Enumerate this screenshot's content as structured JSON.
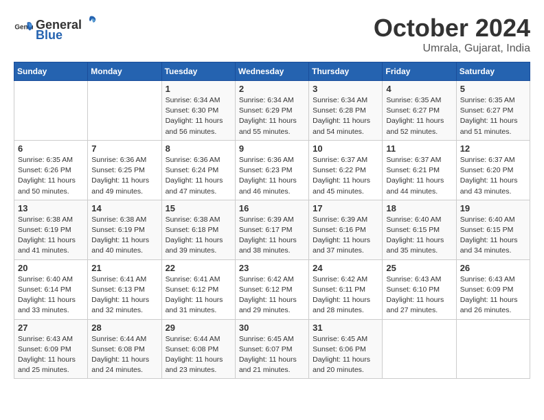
{
  "logo": {
    "general": "General",
    "blue": "Blue"
  },
  "header": {
    "month": "October 2024",
    "location": "Umrala, Gujarat, India"
  },
  "weekdays": [
    "Sunday",
    "Monday",
    "Tuesday",
    "Wednesday",
    "Thursday",
    "Friday",
    "Saturday"
  ],
  "weeks": [
    [
      {
        "day": "",
        "info": ""
      },
      {
        "day": "",
        "info": ""
      },
      {
        "day": "1",
        "info": "Sunrise: 6:34 AM\nSunset: 6:30 PM\nDaylight: 11 hours and 56 minutes."
      },
      {
        "day": "2",
        "info": "Sunrise: 6:34 AM\nSunset: 6:29 PM\nDaylight: 11 hours and 55 minutes."
      },
      {
        "day": "3",
        "info": "Sunrise: 6:34 AM\nSunset: 6:28 PM\nDaylight: 11 hours and 54 minutes."
      },
      {
        "day": "4",
        "info": "Sunrise: 6:35 AM\nSunset: 6:27 PM\nDaylight: 11 hours and 52 minutes."
      },
      {
        "day": "5",
        "info": "Sunrise: 6:35 AM\nSunset: 6:27 PM\nDaylight: 11 hours and 51 minutes."
      }
    ],
    [
      {
        "day": "6",
        "info": "Sunrise: 6:35 AM\nSunset: 6:26 PM\nDaylight: 11 hours and 50 minutes."
      },
      {
        "day": "7",
        "info": "Sunrise: 6:36 AM\nSunset: 6:25 PM\nDaylight: 11 hours and 49 minutes."
      },
      {
        "day": "8",
        "info": "Sunrise: 6:36 AM\nSunset: 6:24 PM\nDaylight: 11 hours and 47 minutes."
      },
      {
        "day": "9",
        "info": "Sunrise: 6:36 AM\nSunset: 6:23 PM\nDaylight: 11 hours and 46 minutes."
      },
      {
        "day": "10",
        "info": "Sunrise: 6:37 AM\nSunset: 6:22 PM\nDaylight: 11 hours and 45 minutes."
      },
      {
        "day": "11",
        "info": "Sunrise: 6:37 AM\nSunset: 6:21 PM\nDaylight: 11 hours and 44 minutes."
      },
      {
        "day": "12",
        "info": "Sunrise: 6:37 AM\nSunset: 6:20 PM\nDaylight: 11 hours and 43 minutes."
      }
    ],
    [
      {
        "day": "13",
        "info": "Sunrise: 6:38 AM\nSunset: 6:19 PM\nDaylight: 11 hours and 41 minutes."
      },
      {
        "day": "14",
        "info": "Sunrise: 6:38 AM\nSunset: 6:19 PM\nDaylight: 11 hours and 40 minutes."
      },
      {
        "day": "15",
        "info": "Sunrise: 6:38 AM\nSunset: 6:18 PM\nDaylight: 11 hours and 39 minutes."
      },
      {
        "day": "16",
        "info": "Sunrise: 6:39 AM\nSunset: 6:17 PM\nDaylight: 11 hours and 38 minutes."
      },
      {
        "day": "17",
        "info": "Sunrise: 6:39 AM\nSunset: 6:16 PM\nDaylight: 11 hours and 37 minutes."
      },
      {
        "day": "18",
        "info": "Sunrise: 6:40 AM\nSunset: 6:15 PM\nDaylight: 11 hours and 35 minutes."
      },
      {
        "day": "19",
        "info": "Sunrise: 6:40 AM\nSunset: 6:15 PM\nDaylight: 11 hours and 34 minutes."
      }
    ],
    [
      {
        "day": "20",
        "info": "Sunrise: 6:40 AM\nSunset: 6:14 PM\nDaylight: 11 hours and 33 minutes."
      },
      {
        "day": "21",
        "info": "Sunrise: 6:41 AM\nSunset: 6:13 PM\nDaylight: 11 hours and 32 minutes."
      },
      {
        "day": "22",
        "info": "Sunrise: 6:41 AM\nSunset: 6:12 PM\nDaylight: 11 hours and 31 minutes."
      },
      {
        "day": "23",
        "info": "Sunrise: 6:42 AM\nSunset: 6:12 PM\nDaylight: 11 hours and 29 minutes."
      },
      {
        "day": "24",
        "info": "Sunrise: 6:42 AM\nSunset: 6:11 PM\nDaylight: 11 hours and 28 minutes."
      },
      {
        "day": "25",
        "info": "Sunrise: 6:43 AM\nSunset: 6:10 PM\nDaylight: 11 hours and 27 minutes."
      },
      {
        "day": "26",
        "info": "Sunrise: 6:43 AM\nSunset: 6:09 PM\nDaylight: 11 hours and 26 minutes."
      }
    ],
    [
      {
        "day": "27",
        "info": "Sunrise: 6:43 AM\nSunset: 6:09 PM\nDaylight: 11 hours and 25 minutes."
      },
      {
        "day": "28",
        "info": "Sunrise: 6:44 AM\nSunset: 6:08 PM\nDaylight: 11 hours and 24 minutes."
      },
      {
        "day": "29",
        "info": "Sunrise: 6:44 AM\nSunset: 6:08 PM\nDaylight: 11 hours and 23 minutes."
      },
      {
        "day": "30",
        "info": "Sunrise: 6:45 AM\nSunset: 6:07 PM\nDaylight: 11 hours and 21 minutes."
      },
      {
        "day": "31",
        "info": "Sunrise: 6:45 AM\nSunset: 6:06 PM\nDaylight: 11 hours and 20 minutes."
      },
      {
        "day": "",
        "info": ""
      },
      {
        "day": "",
        "info": ""
      }
    ]
  ]
}
